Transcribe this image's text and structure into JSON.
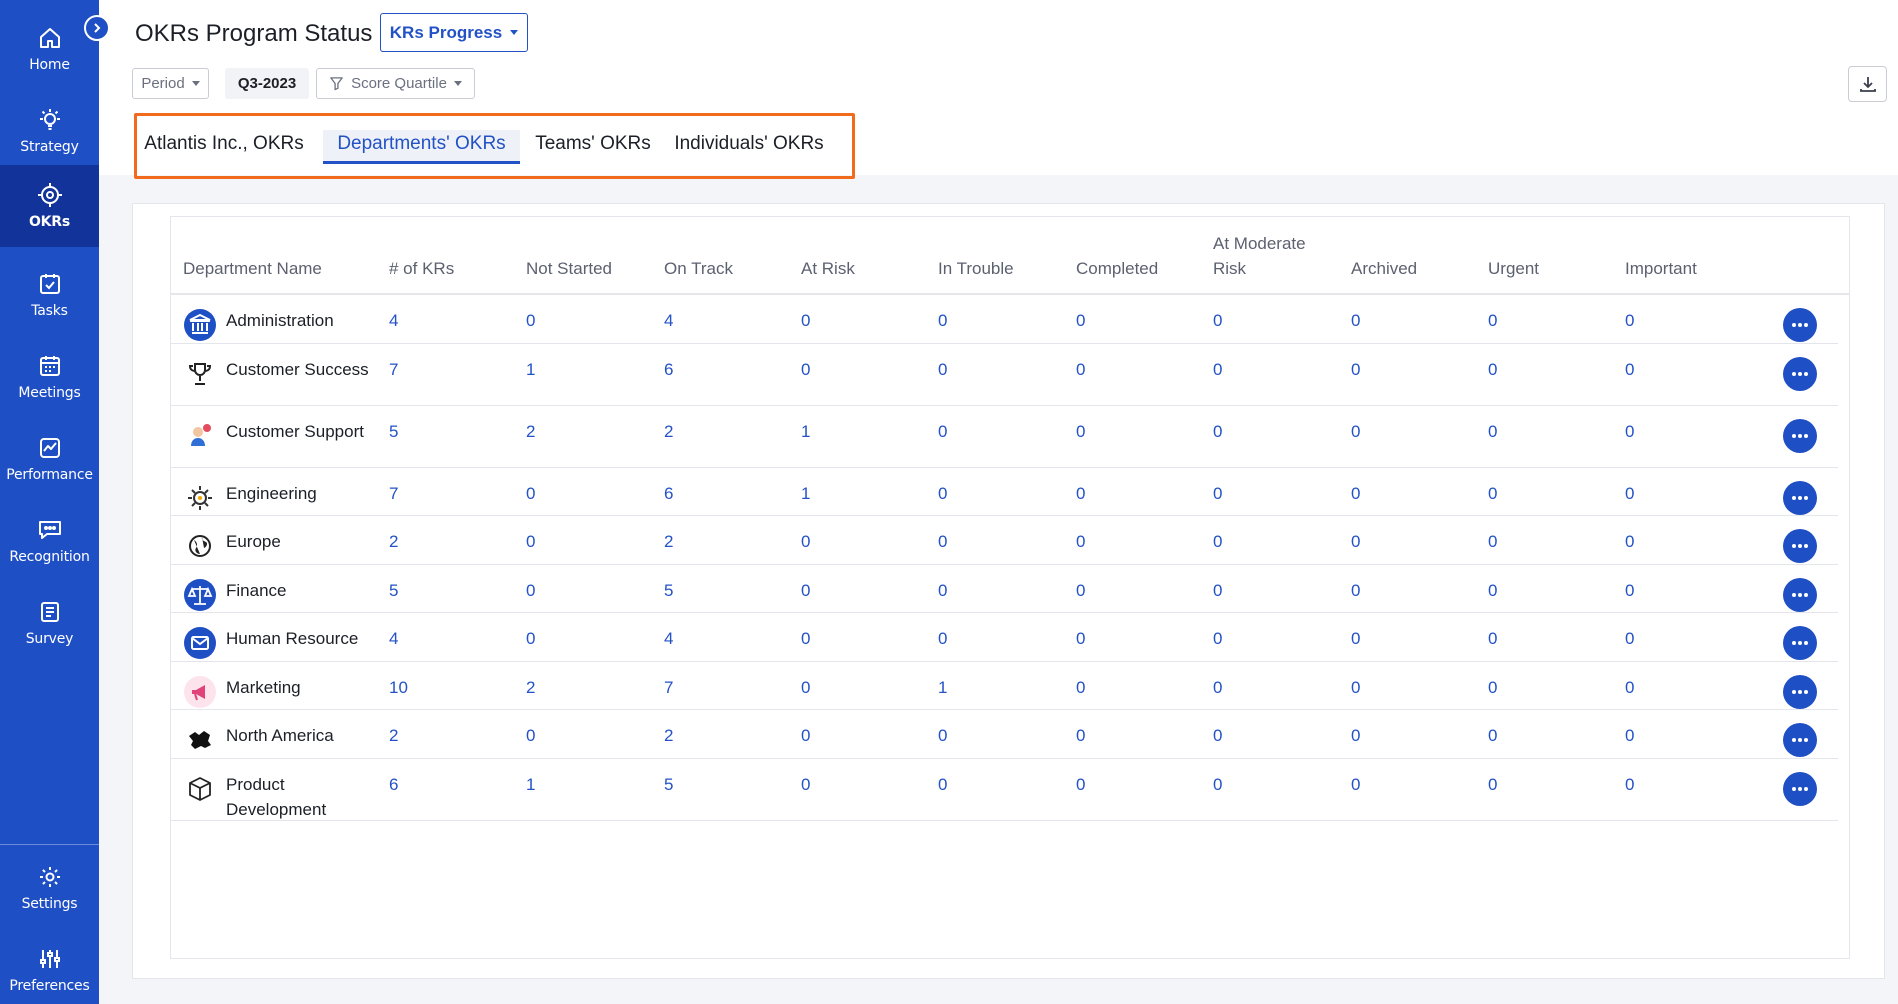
{
  "sidebar": {
    "items": [
      {
        "label": "Home",
        "icon": "home-icon"
      },
      {
        "label": "Strategy",
        "icon": "lightbulb-icon"
      },
      {
        "label": "OKRs",
        "icon": "target-icon",
        "active": true
      },
      {
        "label": "Tasks",
        "icon": "task-icon"
      },
      {
        "label": "Meetings",
        "icon": "calendar-icon"
      },
      {
        "label": "Performance",
        "icon": "chart-icon"
      },
      {
        "label": "Recognition",
        "icon": "chat-icon"
      },
      {
        "label": "Survey",
        "icon": "survey-icon"
      }
    ],
    "bottom_items": [
      {
        "label": "Settings",
        "icon": "gear-icon"
      },
      {
        "label": "Preferences",
        "icon": "sliders-icon"
      }
    ]
  },
  "header": {
    "title": "OKRs Program Status",
    "view_select": "KRs Progress",
    "filters": {
      "period_label": "Period",
      "quarter": "Q3-2023",
      "score_quartile": "Score Quartile"
    }
  },
  "tabs": [
    {
      "label": "Atlantis Inc., OKRs",
      "active": false
    },
    {
      "label": "Departments' OKRs",
      "active": true
    },
    {
      "label": "Teams' OKRs",
      "active": false
    },
    {
      "label": "Individuals' OKRs",
      "active": false
    }
  ],
  "table": {
    "columns": [
      "Department Name",
      "# of KRs",
      "Not Started",
      "On Track",
      "At Risk",
      "In Trouble",
      "Completed",
      "At Moderate Risk",
      "Archived",
      "Urgent",
      "Important"
    ],
    "rows": [
      {
        "name": "Administration",
        "icon": "bank-icon",
        "values": [
          "4",
          "0",
          "4",
          "0",
          "0",
          "0",
          "0",
          "0",
          "0",
          "0"
        ]
      },
      {
        "name": "Customer Success",
        "icon": "trophy-icon",
        "values": [
          "7",
          "1",
          "6",
          "0",
          "0",
          "0",
          "0",
          "0",
          "0",
          "0"
        ]
      },
      {
        "name": "Customer Support",
        "icon": "support-agent-icon",
        "values": [
          "5",
          "2",
          "2",
          "1",
          "0",
          "0",
          "0",
          "0",
          "0",
          "0"
        ]
      },
      {
        "name": "Engineering",
        "icon": "gear-bolt-icon",
        "values": [
          "7",
          "0",
          "6",
          "1",
          "0",
          "0",
          "0",
          "0",
          "0",
          "0"
        ]
      },
      {
        "name": "Europe",
        "icon": "globe-icon",
        "values": [
          "2",
          "0",
          "2",
          "0",
          "0",
          "0",
          "0",
          "0",
          "0",
          "0"
        ]
      },
      {
        "name": "Finance",
        "icon": "scales-icon",
        "values": [
          "5",
          "0",
          "5",
          "0",
          "0",
          "0",
          "0",
          "0",
          "0",
          "0"
        ]
      },
      {
        "name": "Human Resource",
        "icon": "mail-icon",
        "values": [
          "4",
          "0",
          "4",
          "0",
          "0",
          "0",
          "0",
          "0",
          "0",
          "0"
        ]
      },
      {
        "name": "Marketing",
        "icon": "megaphone-icon",
        "values": [
          "10",
          "2",
          "7",
          "0",
          "1",
          "0",
          "0",
          "0",
          "0",
          "0"
        ]
      },
      {
        "name": "North America",
        "icon": "map-icon",
        "values": [
          "2",
          "0",
          "2",
          "0",
          "0",
          "0",
          "0",
          "0",
          "0",
          "0"
        ]
      },
      {
        "name": "Product Development",
        "icon": "box-icon",
        "values": [
          "6",
          "1",
          "5",
          "0",
          "0",
          "0",
          "0",
          "0",
          "0",
          "0"
        ]
      }
    ]
  },
  "colors": {
    "sidebar": "#1f4fc4",
    "sidebar_active": "#12339a",
    "accent": "#2352c6",
    "tab_highlight_border": "#f26a1b"
  }
}
